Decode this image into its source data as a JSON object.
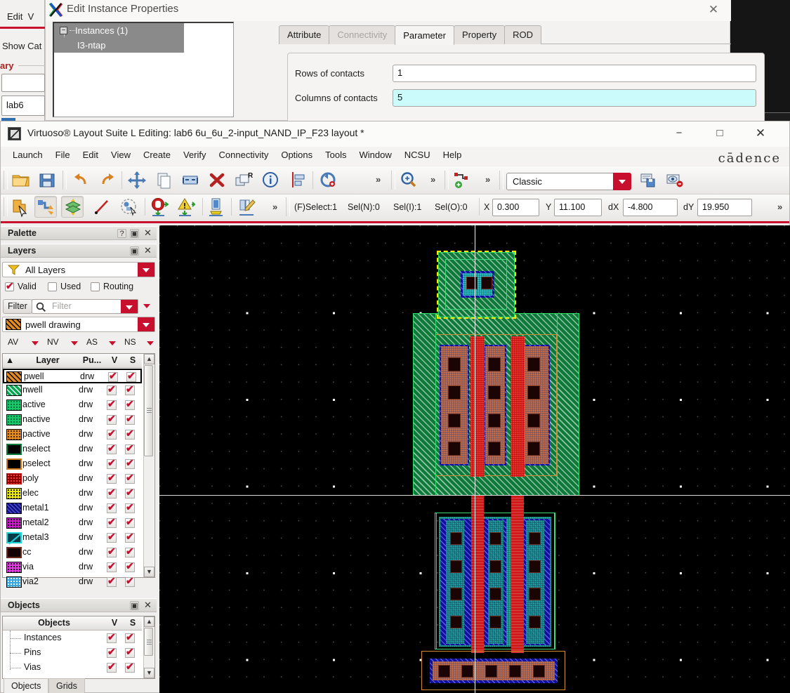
{
  "background_window": {
    "menu_items": [
      "Edit",
      "V"
    ],
    "show_category_label": "Show Cat",
    "library_label": "ary",
    "lib_value": "lab6"
  },
  "dialog": {
    "title": "Edit Instance Properties",
    "close_icon": "close-icon",
    "tree": {
      "root_label": "Instances (1)",
      "child_label": "I3-ntap",
      "expander": "−"
    },
    "tabs": [
      {
        "label": "Attribute",
        "state": "normal"
      },
      {
        "label": "Connectivity",
        "state": "disabled"
      },
      {
        "label": "Parameter",
        "state": "active"
      },
      {
        "label": "Property",
        "state": "normal"
      },
      {
        "label": "ROD",
        "state": "normal"
      }
    ],
    "fields": [
      {
        "label": "Rows of contacts",
        "value": "1",
        "highlight": false
      },
      {
        "label": "Columns of contacts",
        "value": "5",
        "highlight": true
      }
    ]
  },
  "main_window": {
    "title": "Virtuoso® Layout Suite L Editing: lab6 6u_6u_2-input_NAND_IP_F23 layout *",
    "window_buttons": {
      "minimize": "−",
      "maximize": "□",
      "close": "✕"
    },
    "brand": "cādence",
    "menu": [
      "Launch",
      "File",
      "Edit",
      "View",
      "Create",
      "Verify",
      "Connectivity",
      "Options",
      "Tools",
      "Window",
      "NCSU",
      "Help"
    ],
    "toolbar_row1_icons": [
      "open-folder-icon",
      "save-icon",
      "undo-icon",
      "redo-icon",
      "move-icon",
      "copy-icon",
      "stretch-icon",
      "delete-icon",
      "rotate-r-icon",
      "properties-info-icon",
      "align-icon",
      "undo-selection-icon",
      "more-chevron",
      "zoom-icon",
      "more-chevron-2",
      "create-instance-icon",
      "more-chevron-3"
    ],
    "toolbar_row2_icons": [
      "select-arrow-icon",
      "partial-select-icon",
      "layer-select-icon",
      "ruler-icon",
      "edit-in-place-icon",
      "stop-hierarchy-icon",
      "warning-hierarchy-icon",
      "descend-icon",
      "edit-mode-icon",
      "more-chevron-4"
    ],
    "classic_combo": {
      "value": "Classic",
      "dropdown_icon": "chevron-down-icon"
    },
    "layout_icons": [
      "save-layout-icon",
      "remove-layout-icon"
    ],
    "status": {
      "select_mode": "(F)Select:1",
      "sel_n": "Sel(N):0",
      "sel_i": "Sel(I):1",
      "sel_o": "Sel(O):0"
    },
    "coords": [
      {
        "label": "X",
        "value": "0.300"
      },
      {
        "label": "Y",
        "value": "11.100"
      },
      {
        "label": "dX",
        "value": "-4.800"
      },
      {
        "label": "dY",
        "value": "19.950"
      }
    ],
    "overflow_chevron": "»"
  },
  "palette": {
    "title": "Palette",
    "buttons": [
      "?",
      "▣",
      "✕"
    ],
    "layers_title": "Layers",
    "layers_buttons": [
      "▣",
      "✕"
    ],
    "all_layers": {
      "label": "All Layers",
      "icon": "filter-funnel-icon"
    },
    "checkboxes": [
      {
        "label": "Valid",
        "checked": true
      },
      {
        "label": "Used",
        "checked": false
      },
      {
        "label": "Routing",
        "checked": false
      }
    ],
    "filter": {
      "button_label": "Filter",
      "placeholder": "Filter",
      "icon": "search-icon"
    },
    "current_layer": {
      "label": "pwell drawing",
      "swatch": "#e08a20"
    },
    "sort_controls": [
      "AV",
      "NV",
      "AS",
      "NS"
    ],
    "table_headers": [
      "Layer",
      "Pu...",
      "V",
      "S"
    ],
    "layers": [
      {
        "name": "pwell",
        "purpose": "drw",
        "v": true,
        "s": true,
        "color": "#e08a20",
        "pattern": "diag",
        "selected": true
      },
      {
        "name": "nwell",
        "purpose": "drw",
        "v": true,
        "s": true,
        "color": "#00a84f",
        "pattern": "diag",
        "selected": false
      },
      {
        "name": "active",
        "purpose": "drw",
        "v": true,
        "s": true,
        "color": "#18c96b",
        "pattern": "dots",
        "selected": false
      },
      {
        "name": "nactive",
        "purpose": "drw",
        "v": true,
        "s": true,
        "color": "#18c96b",
        "pattern": "dots",
        "selected": false
      },
      {
        "name": "pactive",
        "purpose": "drw",
        "v": true,
        "s": true,
        "color": "#e08a20",
        "pattern": "dots",
        "selected": false
      },
      {
        "name": "nselect",
        "purpose": "drw",
        "v": true,
        "s": true,
        "color": "#0a7a3a",
        "pattern": "solid",
        "selected": false
      },
      {
        "name": "pselect",
        "purpose": "drw",
        "v": true,
        "s": true,
        "color": "#d07a1c",
        "pattern": "solid",
        "selected": false
      },
      {
        "name": "poly",
        "purpose": "drw",
        "v": true,
        "s": true,
        "color": "#c81414",
        "pattern": "dots",
        "selected": false
      },
      {
        "name": "elec",
        "purpose": "drw",
        "v": true,
        "s": true,
        "color": "#e8e80c",
        "pattern": "dots",
        "selected": false
      },
      {
        "name": "metal1",
        "purpose": "drw",
        "v": true,
        "s": true,
        "color": "#1a1acf",
        "pattern": "diag",
        "selected": false
      },
      {
        "name": "metal2",
        "purpose": "drw",
        "v": true,
        "s": true,
        "color": "#cf18cf",
        "pattern": "dots",
        "selected": false
      },
      {
        "name": "metal3",
        "purpose": "drw",
        "v": true,
        "s": true,
        "color": "#18d8d8",
        "pattern": "slash",
        "selected": false
      },
      {
        "name": "cc",
        "purpose": "drw",
        "v": true,
        "s": true,
        "color": "#6b2a1a",
        "pattern": "solid",
        "selected": false
      },
      {
        "name": "via",
        "purpose": "drw",
        "v": true,
        "s": true,
        "color": "#e838e8",
        "pattern": "dots",
        "selected": false
      },
      {
        "name": "via2",
        "purpose": "drw",
        "v": true,
        "s": true,
        "color": "#3aa8e0",
        "pattern": "dots",
        "selected": false
      }
    ]
  },
  "objects_panel": {
    "title": "Objects",
    "buttons": [
      "▣",
      "✕"
    ],
    "headers": [
      "Objects",
      "V",
      "S"
    ],
    "rows": [
      {
        "name": "Instances",
        "v": true,
        "s": true
      },
      {
        "name": "Pins",
        "v": true,
        "s": true
      },
      {
        "name": "Vias",
        "v": true,
        "s": true
      }
    ],
    "bottom_tabs": [
      {
        "label": "Objects",
        "active": true
      },
      {
        "label": "Grids",
        "active": false
      }
    ]
  },
  "canvas": {
    "background": "#000000",
    "grid_minor_color": "#555555",
    "grid_major_color": "#ffffff",
    "ruler_line_color": "#d8d8d8",
    "cursor_line_color": "#f2f2f2",
    "selection_color": "#ffe400",
    "description": "CMOS 2-input NAND gate layout: ntap (selected), PMOS pair in nwell, NMOS pair in pwell, ptap at bottom"
  }
}
